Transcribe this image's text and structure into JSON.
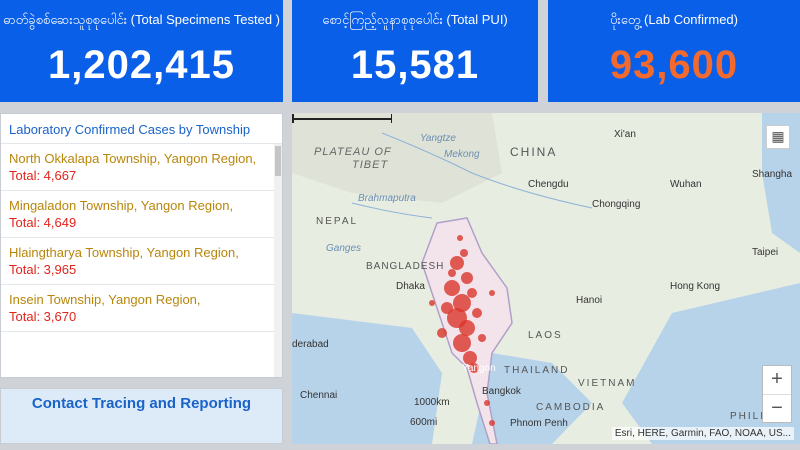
{
  "stats": [
    {
      "label": "ဓာတ်ခွဲစစ်ဆေးသူစုစုပေါင်း (Total Specimens Tested )",
      "value": "1,202,415"
    },
    {
      "label": "စောင့်ကြည့်လူနာစုစုပေါင်း (Total PUI)",
      "value": "15,581"
    },
    {
      "label": "ပိုးတွေ့ (Lab Confirmed)",
      "value": "93,600",
      "color": "#f36a2e"
    }
  ],
  "list": {
    "title": "Laboratory Confirmed Cases by Township",
    "items": [
      {
        "name": "North Okkalapa Township, Yangon Region,",
        "total": "Total: 4,667"
      },
      {
        "name": "Mingaladon Township, Yangon Region,",
        "total": "Total: 4,649"
      },
      {
        "name": "Hlaingtharya Township, Yangon Region,",
        "total": "Total: 3,965"
      },
      {
        "name": "Insein Township, Yangon Region,",
        "total": "Total: 3,670"
      }
    ]
  },
  "contact_panel": {
    "title": "Contact Tracing and Reporting"
  },
  "map": {
    "labels": {
      "plateau": "PLATEAU OF",
      "tibet": "TIBET",
      "china": "CHINA",
      "nepal": "NEPAL",
      "bangladesh": "BANGLADESH",
      "laos": "LAOS",
      "thailand": "THAILAND",
      "vietnam": "VIETNAM",
      "cambodia": "CAMBODIA",
      "philippines": "PHILI",
      "xian": "Xi'an",
      "chengdu": "Chengdu",
      "wuhan": "Wuhan",
      "shanghai": "Shangha",
      "chongqing": "Chongqing",
      "taipei": "Taipei",
      "hongkong": "Hong Kong",
      "hanoi": "Hanoi",
      "dhaka": "Dhaka",
      "bangkok": "Bangkok",
      "phnompenh": "Phnom Penh",
      "chennai": "Chennai",
      "derabad": "derabad",
      "yangtze": "Yangtze",
      "mekong": "Mekong",
      "brahmaputra": "Brahmaputra",
      "ganges": "Ganges",
      "yangon": "Yangon"
    },
    "scale_km": "1000km",
    "scale_mi": "600mi",
    "zoom_in": "+",
    "zoom_out": "−",
    "attribution": "Esri, HERE, Garmin, FAO, NOAA, US..."
  }
}
